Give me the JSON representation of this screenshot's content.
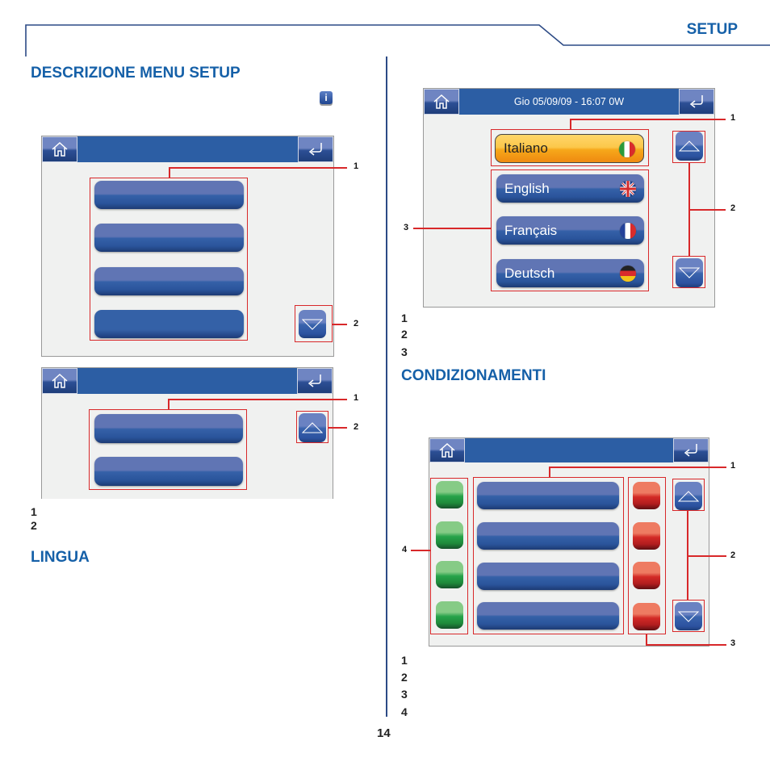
{
  "header": {
    "section_label": "SETUP",
    "accent_color": "#1560a8",
    "frame_color": "#2c4a85"
  },
  "left": {
    "title": "DESCRIZIONE MENU SETUP",
    "info_icon": "info-icon",
    "screen_a": {
      "home_icon": "home-icon",
      "back_icon": "return-arrow-icon",
      "menu_buttons": [
        "",
        "",
        "",
        ""
      ],
      "scroll_icon": "arrow-down-icon",
      "callouts": [
        "1",
        "2"
      ]
    },
    "screen_b": {
      "home_icon": "home-icon",
      "back_icon": "return-arrow-icon",
      "menu_buttons": [
        "",
        ""
      ],
      "scroll_icon": "arrow-up-icon",
      "callouts": [
        "1",
        "2"
      ]
    },
    "legend": [
      "1",
      "2"
    ],
    "section2_title": "LINGUA"
  },
  "right": {
    "lingua_screen": {
      "status_text": "Gio 05/09/09 - 16:07   0W",
      "home_icon": "home-icon",
      "back_icon": "return-arrow-icon",
      "selected_language": {
        "label": "Italiano",
        "flag": "flag-italy-icon"
      },
      "languages": [
        {
          "label": "English",
          "flag": "flag-uk-icon"
        },
        {
          "label": "Français",
          "flag": "flag-france-icon"
        },
        {
          "label": "Deutsch",
          "flag": "flag-germany-icon"
        }
      ],
      "callouts": [
        "1",
        "2",
        "3"
      ]
    },
    "lingua_legend": [
      "1",
      "2",
      "3"
    ],
    "section_title": "CONDIZIONAMENTI",
    "cond_screen": {
      "home_icon": "home-icon",
      "back_icon": "return-arrow-icon",
      "rows": 4,
      "callouts": [
        "1",
        "2",
        "3",
        "4"
      ]
    },
    "cond_legend": [
      "1",
      "2",
      "3",
      "4"
    ]
  },
  "footer": {
    "page_number": "14"
  }
}
